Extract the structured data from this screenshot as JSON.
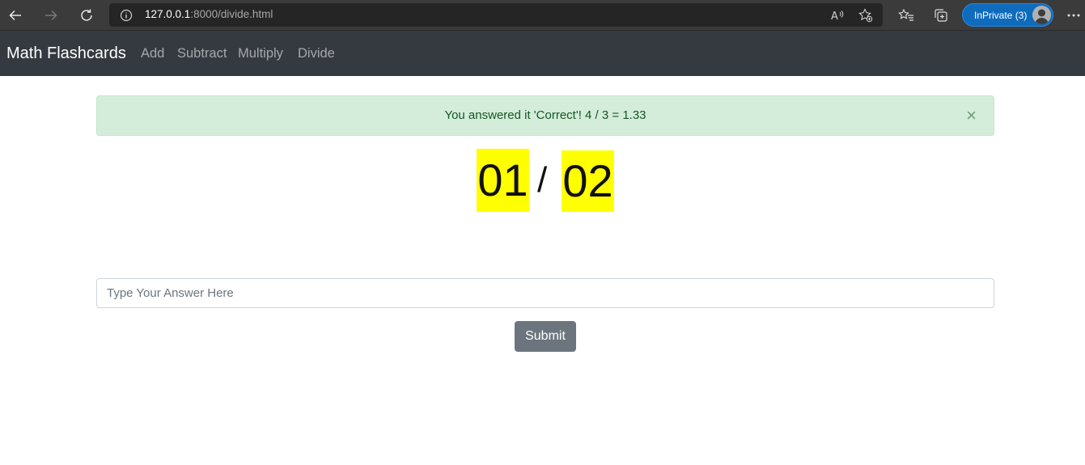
{
  "browser": {
    "url_host": "127.0.0.1",
    "url_rest": ":8000/divide.html",
    "inprivate_label": "InPrivate (3)",
    "icons": [
      "back-icon",
      "forward-icon",
      "refresh-icon",
      "info-icon",
      "read-aloud-icon",
      "favorite-add-icon",
      "favorites-icon",
      "collections-icon",
      "more-icon"
    ]
  },
  "navbar": {
    "brand": "Math Flashcards",
    "links": [
      "Add",
      "Subtract",
      "Multiply",
      "Divide"
    ]
  },
  "alert": {
    "message": "You answered it 'Correct'! 4 / 3 = 1.33",
    "close": "×",
    "color": "#d4edda"
  },
  "problem": {
    "left": "01",
    "operator": "/",
    "right": "02",
    "highlight_color": "#ffff00"
  },
  "form": {
    "placeholder": "Type Your Answer Here",
    "value": "",
    "submit_label": "Submit"
  }
}
